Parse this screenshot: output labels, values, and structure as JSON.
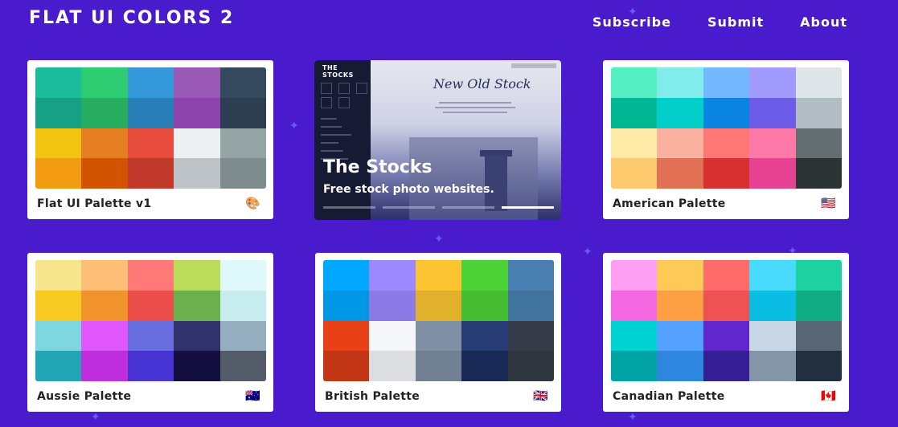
{
  "header": {
    "brand": "FLAT UI COLORS 2",
    "nav": [
      "Subscribe",
      "Submit",
      "About"
    ]
  },
  "promo": {
    "side_title": "THE STOCKS",
    "script_title": "New Old Stock",
    "title": "The Stocks",
    "subtitle": "Free stock photo websites.",
    "active_slide": 4,
    "slide_count": 4
  },
  "palettes": [
    {
      "name": "Flat UI Palette v1",
      "icon": "palette-icon",
      "icon_glyph": "🎨",
      "colors": [
        "#1abc9c",
        "#2ecc71",
        "#3498db",
        "#9b59b6",
        "#34495e",
        "#16a085",
        "#27ae60",
        "#2980b9",
        "#8e44ad",
        "#2c3e50",
        "#f1c40f",
        "#e67e22",
        "#e74c3c",
        "#ecf0f1",
        "#95a5a6",
        "#f39c12",
        "#d35400",
        "#c0392b",
        "#bdc3c7",
        "#7f8c8d"
      ]
    },
    {
      "name": "American Palette",
      "icon": "us-flag-icon",
      "icon_glyph": "🇺🇸",
      "colors": [
        "#55efc4",
        "#81ecec",
        "#74b9ff",
        "#a29bfe",
        "#dfe6e9",
        "#00b894",
        "#00cec9",
        "#0984e3",
        "#6c5ce7",
        "#b2bec3",
        "#ffeaa7",
        "#fab1a0",
        "#ff7675",
        "#fd79a8",
        "#636e72",
        "#fdcb6e",
        "#e17055",
        "#d63031",
        "#e84393",
        "#2d3436"
      ]
    },
    {
      "name": "Aussie Palette",
      "icon": "australia-flag-icon",
      "icon_glyph": "🇦🇺",
      "colors": [
        "#f6e58d",
        "#ffbe76",
        "#ff7979",
        "#badc58",
        "#dff9fb",
        "#f9ca24",
        "#f0932b",
        "#eb4d4b",
        "#6ab04c",
        "#c7ecee",
        "#7ed6df",
        "#e056fd",
        "#686de0",
        "#30336b",
        "#95afc0",
        "#22a6b3",
        "#be2edd",
        "#4834d4",
        "#130f40",
        "#535c68"
      ]
    },
    {
      "name": "British Palette",
      "icon": "uk-flag-icon",
      "icon_glyph": "🇬🇧",
      "colors": [
        "#00a8ff",
        "#9c88ff",
        "#fbc531",
        "#4cd137",
        "#487eb0",
        "#0097e6",
        "#8c7ae6",
        "#e1b12c",
        "#44bd32",
        "#40739e",
        "#e84118",
        "#f5f6fa",
        "#7f8fa6",
        "#273c75",
        "#353b48",
        "#c23616",
        "#dcdde1",
        "#718093",
        "#192a56",
        "#2f3640"
      ]
    },
    {
      "name": "Canadian Palette",
      "icon": "canada-flag-icon",
      "icon_glyph": "🇨🇦",
      "colors": [
        "#ff9ff3",
        "#feca57",
        "#ff6b6b",
        "#48dbfb",
        "#1dd1a1",
        "#f368e0",
        "#ff9f43",
        "#ee5253",
        "#0abde3",
        "#10ac84",
        "#00d2d3",
        "#54a0ff",
        "#5f27cd",
        "#c8d6e5",
        "#576574",
        "#01a3a4",
        "#2e86de",
        "#341f97",
        "#8395a7",
        "#222f3e"
      ]
    }
  ]
}
